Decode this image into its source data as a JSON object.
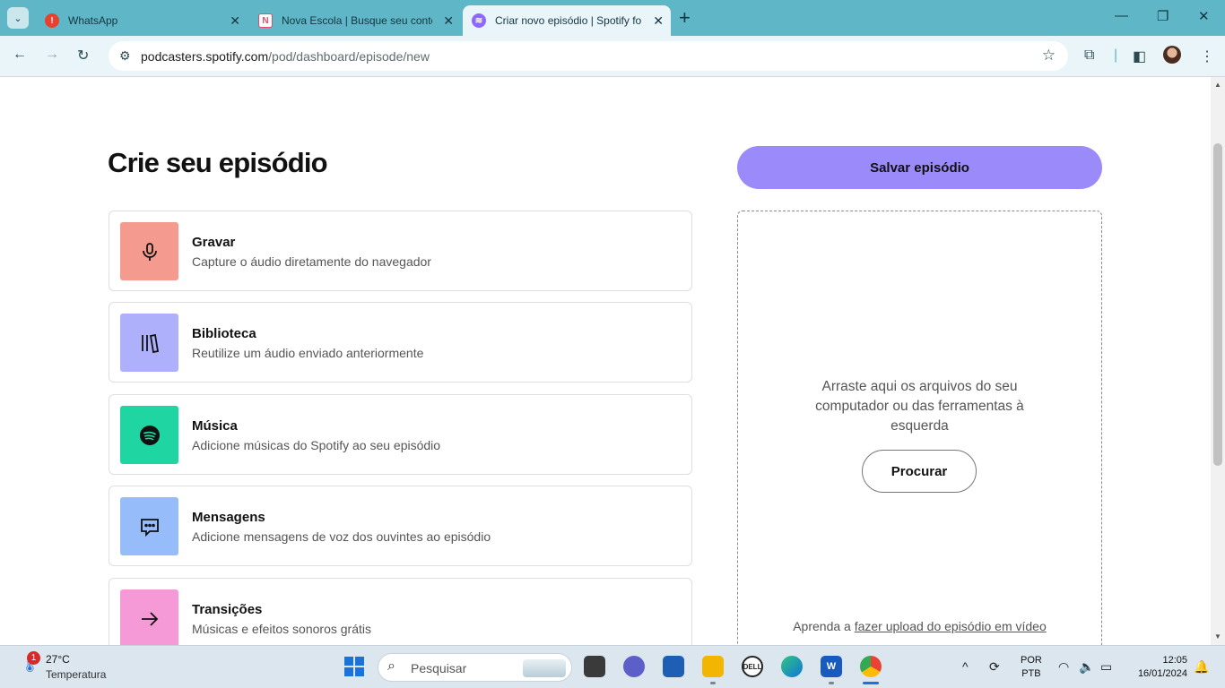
{
  "browser": {
    "tabs": [
      {
        "title": "WhatsApp",
        "favicon_color": "#e8412f",
        "favicon_icon": "alert-icon"
      },
      {
        "title": "Nova Escola | Busque seu conte",
        "favicon_color": "#e64a6a",
        "favicon_letter": "N"
      },
      {
        "title": "Criar novo episódio | Spotify fo",
        "favicon_color": "#8d67ff",
        "favicon_icon": "podcast-icon",
        "active": true
      }
    ],
    "url_host": "podcasters.spotify.com",
    "url_path": "/pod/dashboard/episode/new"
  },
  "page": {
    "heading": "Crie seu episódio",
    "tools": [
      {
        "name": "Gravar",
        "desc": "Capture o áudio diretamente do navegador",
        "color": "#f59a8e",
        "icon": "microphone-icon"
      },
      {
        "name": "Biblioteca",
        "desc": "Reutilize um áudio enviado anteriormente",
        "color": "#afb0fb",
        "icon": "library-icon"
      },
      {
        "name": "Música",
        "desc": "Adicione músicas do Spotify ao seu episódio",
        "color": "#1fd6a2",
        "icon": "spotify-icon"
      },
      {
        "name": "Mensagens",
        "desc": "Adicione mensagens de voz dos ouvintes ao episódio",
        "color": "#96bdfa",
        "icon": "message-icon"
      },
      {
        "name": "Transições",
        "desc": "Músicas e efeitos sonoros grátis",
        "color": "#f59ad6",
        "icon": "arrow-right-icon"
      }
    ],
    "save_label": "Salvar episódio",
    "save_color": "#9b8af9",
    "drop_text": "Arraste aqui os arquivos do seu computador ou das ferramentas à esquerda",
    "browse_label": "Procurar",
    "video_prefix": "Aprenda a ",
    "video_link": "fazer upload do episódio em vídeo"
  },
  "taskbar": {
    "weather_badge": "1",
    "weather_temp": "27°C",
    "weather_cond": "Temperatura",
    "search_placeholder": "Pesquisar",
    "lang_1": "POR",
    "lang_2": "PTB",
    "time": "12:05",
    "date": "16/01/2024"
  }
}
